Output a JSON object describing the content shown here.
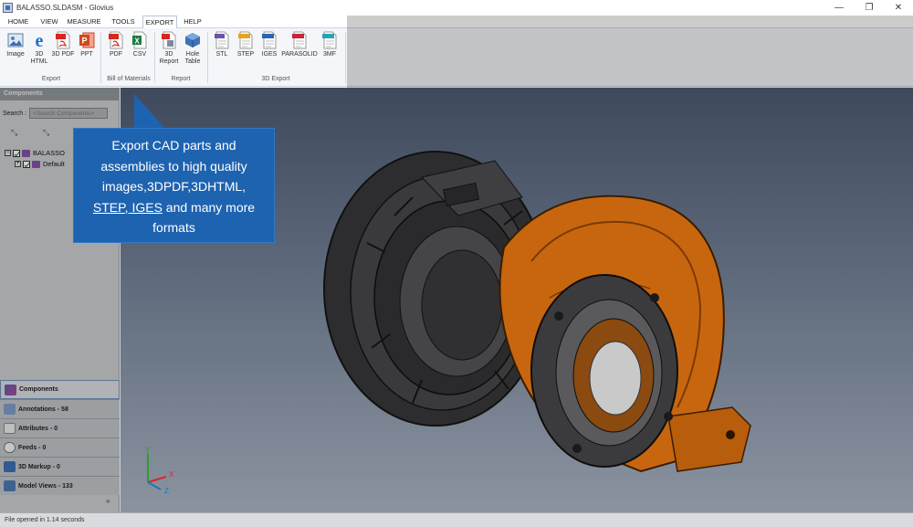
{
  "window": {
    "title": "BALASSO.SLDASM - Glovius",
    "controls": [
      "—",
      "❐",
      "✕"
    ]
  },
  "menu": {
    "tabs": [
      "HOME",
      "VIEW",
      "MEASURE",
      "TOOLS",
      "EXPORT",
      "HELP"
    ],
    "active": "EXPORT"
  },
  "ribbon": {
    "groups": [
      {
        "label": "Export",
        "buttons": [
          "Image",
          "3D HTML",
          "3D PDF",
          "PPT"
        ]
      },
      {
        "label": "Bill of Materials",
        "buttons": [
          "PDF",
          "CSV"
        ]
      },
      {
        "label": "Report",
        "buttons": [
          "3D Report",
          "Hole Table"
        ]
      },
      {
        "label": "3D Export",
        "buttons": [
          "STL",
          "STEP",
          "IGES",
          "PARASOLID",
          "3MF"
        ]
      }
    ]
  },
  "panel": {
    "header": "Components",
    "search_label": "Search :",
    "search_placeholder": "<Search Components>",
    "tree": [
      "BALASSO",
      "Default"
    ],
    "tabs": [
      "Components",
      "Annotations - 58",
      "Attributes - 0",
      "Feeds - 0",
      "3D Markup - 0",
      "Model Views - 133"
    ],
    "expand_glyph": "»"
  },
  "callout": {
    "line1": "Export CAD parts and",
    "line2": "assemblies to high quality",
    "line3": "images,3DPDF,3DHTML,",
    "line4_link": "STEP, IGES",
    "line4_rest": " and many more",
    "line5": "formats"
  },
  "axes": {
    "y": "Y",
    "x": "X",
    "z": "Z"
  },
  "status": "File opened in 1.14 seconds",
  "colors": {
    "accent": "#1e63b0",
    "housing": "#c8660f",
    "compressor": "#3a3a3a"
  }
}
